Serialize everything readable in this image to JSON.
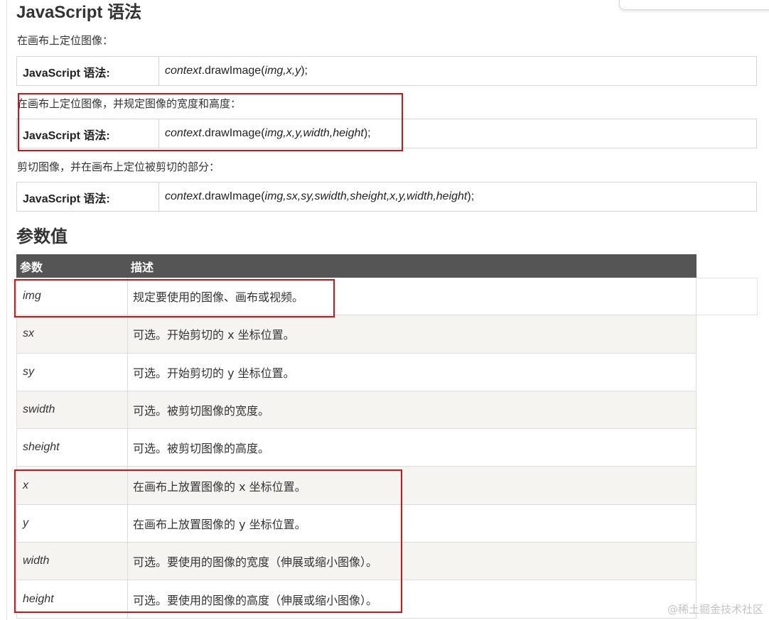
{
  "syntax": {
    "heading": "JavaScript 语法",
    "blocks": [
      {
        "intro": "在画布上定位图像：",
        "label": "JavaScript 语法:",
        "ctx": "context",
        "method": ".drawImage(",
        "args": "img,x,y",
        "close": ");"
      },
      {
        "intro": "在画布上定位图像，并规定图像的宽度和高度：",
        "label": "JavaScript 语法:",
        "ctx": "context",
        "method": ".drawImage(",
        "args": "img,x,y,width,height",
        "close": ");"
      },
      {
        "intro": "剪切图像，并在画布上定位被剪切的部分：",
        "label": "JavaScript 语法:",
        "ctx": "context",
        "method": ".drawImage(",
        "args": "img,sx,sy,swidth,sheight,x,y,width,height",
        "close": ");"
      }
    ]
  },
  "params": {
    "heading": "参数值",
    "columns": [
      "参数",
      "描述"
    ],
    "rows": [
      {
        "name": "img",
        "desc": "规定要使用的图像、画布或视频。"
      },
      {
        "name": "sx",
        "desc": "可选。开始剪切的 x 坐标位置。"
      },
      {
        "name": "sy",
        "desc": "可选。开始剪切的 y 坐标位置。"
      },
      {
        "name": "swidth",
        "desc": "可选。被剪切图像的宽度。"
      },
      {
        "name": "sheight",
        "desc": "可选。被剪切图像的高度。"
      },
      {
        "name": "x",
        "desc": "在画布上放置图像的 x 坐标位置。"
      },
      {
        "name": "y",
        "desc": "在画布上放置图像的 y 坐标位置。"
      },
      {
        "name": "width",
        "desc": "可选。要使用的图像的宽度（伸展或缩小图像）。"
      },
      {
        "name": "height",
        "desc": "可选。要使用的图像的高度（伸展或缩小图像）。"
      }
    ]
  },
  "watermark": "@稀土掘金技术社区",
  "colors": {
    "header_bg": "#555555",
    "highlight": "#d0121b",
    "row_alt": "#f5f4f1"
  }
}
